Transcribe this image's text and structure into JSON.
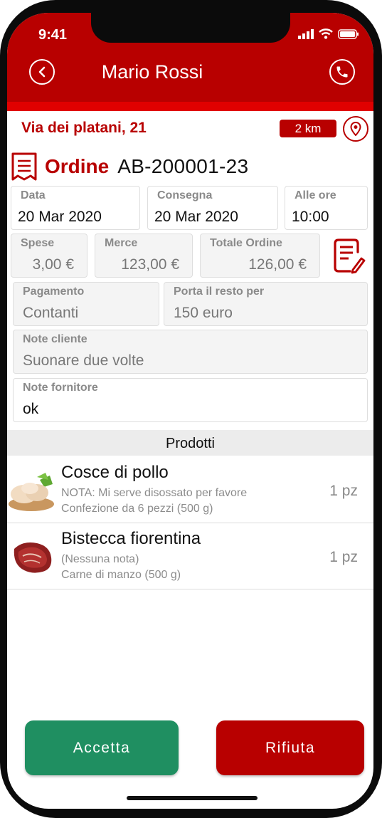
{
  "status_bar": {
    "time": "9:41"
  },
  "header": {
    "title": "Mario Rossi"
  },
  "delivery": {
    "address": "Via dei platani, 21",
    "distance": "2 km"
  },
  "order": {
    "label": "Ordine",
    "code": "AB-200001-23"
  },
  "dates": {
    "data_label": "Data",
    "data_value": "20 Mar 2020",
    "consegna_label": "Consegna",
    "consegna_value": "20 Mar 2020",
    "ore_label": "Alle ore",
    "ore_value": "10:00"
  },
  "totals": {
    "spese_label": "Spese",
    "spese_value": "3,00 €",
    "merce_label": "Merce",
    "merce_value": "123,00 €",
    "totale_label": "Totale Ordine",
    "totale_value": "126,00 €"
  },
  "payment": {
    "pagamento_label": "Pagamento",
    "pagamento_value": "Contanti",
    "resto_label": "Porta il resto per",
    "resto_value": "150 euro"
  },
  "notes": {
    "cliente_label": "Note cliente",
    "cliente_value": "Suonare due volte",
    "fornitore_label": "Note fornitore",
    "fornitore_value": "ok"
  },
  "products_section": {
    "title": "Prodotti"
  },
  "products": [
    {
      "name": "Cosce di pollo",
      "note": "NOTA: Mi serve disossato per favore",
      "description": "Confezione da 6 pezzi (500 g)",
      "qty": "1 pz"
    },
    {
      "name": "Bistecca fiorentina",
      "note": "(Nessuna nota)",
      "description": "Carne di manzo (500 g)",
      "qty": "1 pz"
    }
  ],
  "actions": {
    "accept": "Accetta",
    "reject": "Rifiuta"
  },
  "colors": {
    "brand_red": "#b80000",
    "accent_red": "#e00000",
    "accept_green": "#1f8f61"
  },
  "icons": [
    "back-icon",
    "phone-icon",
    "map-pin-icon",
    "receipt-icon",
    "edit-notes-icon"
  ]
}
